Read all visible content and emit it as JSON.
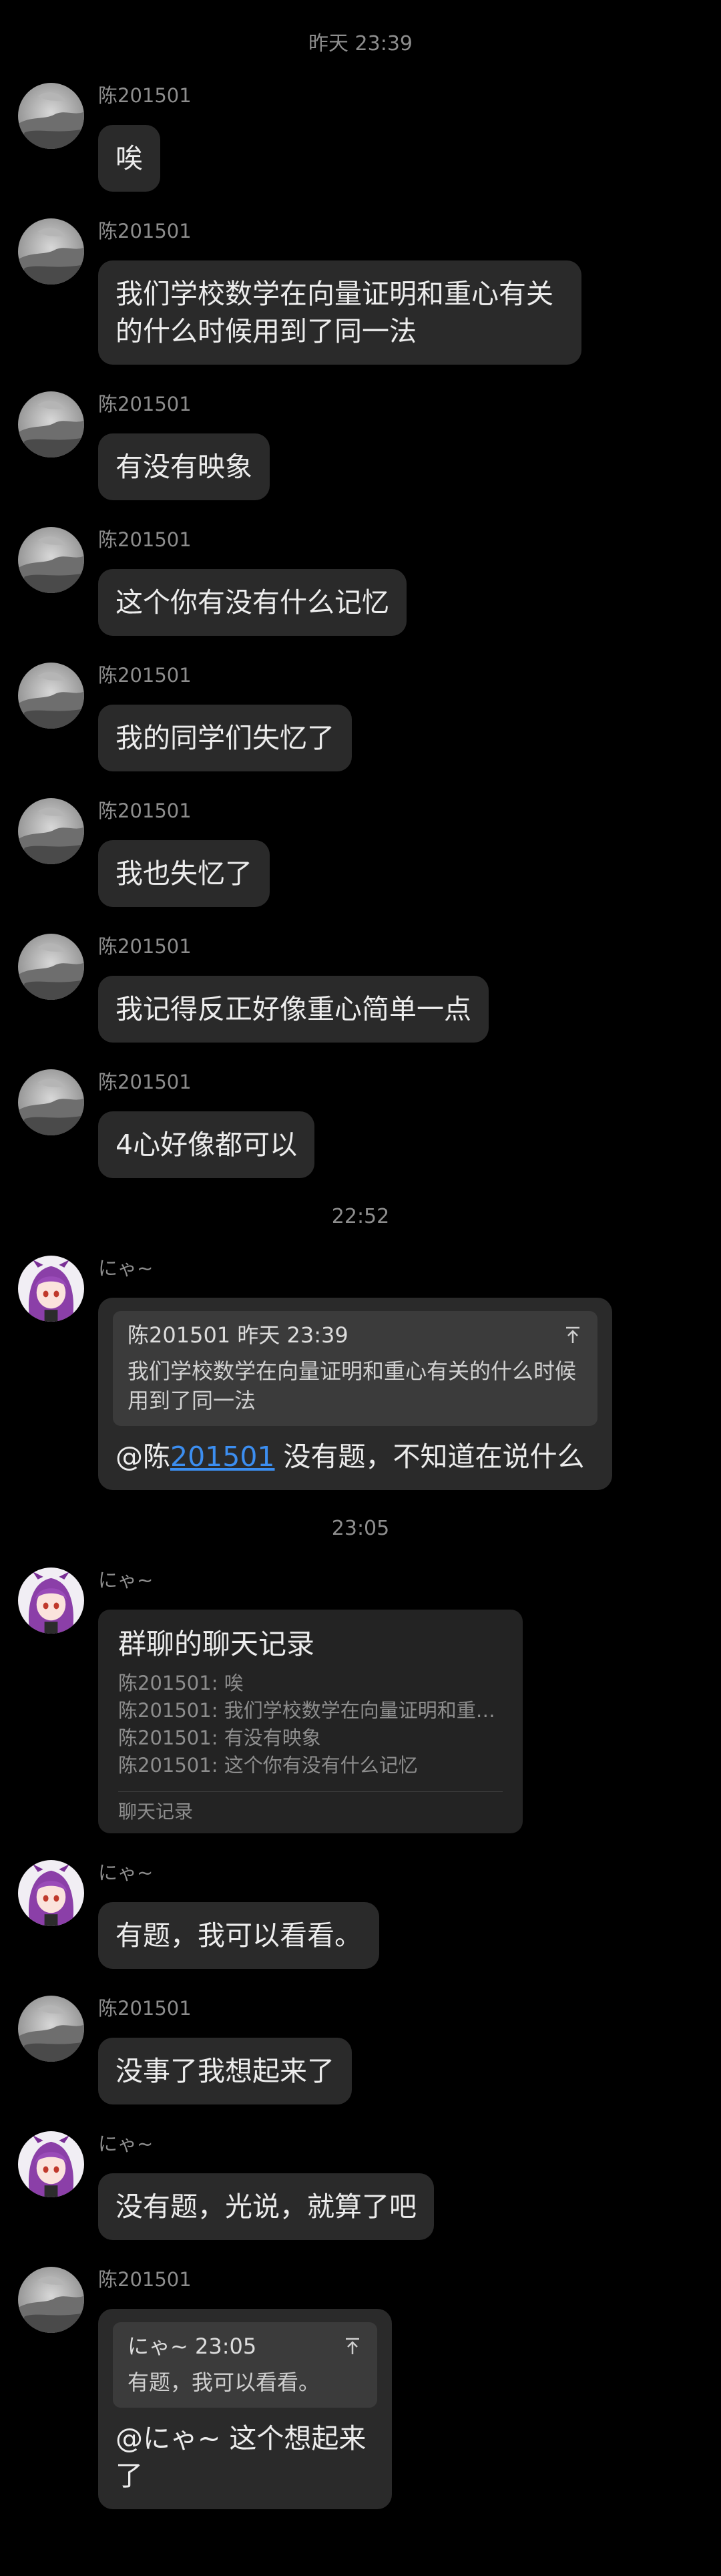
{
  "colors": {
    "background": "#000000",
    "bubble": "#2a2a2a",
    "quote_box": "#3b3b3b",
    "mention_link": "#3c8ef0",
    "meta_text": "#8d8d8d"
  },
  "chat": {
    "time_1": "昨天 23:39",
    "time_2": "22:52",
    "time_3": "23:05",
    "messages": [
      {
        "sender": "陈201501",
        "avatar": "gray-avatar",
        "text": "唉"
      },
      {
        "sender": "陈201501",
        "avatar": "gray-avatar",
        "text": "我们学校数学在向量证明和重心有关的什么时候用到了同一法"
      },
      {
        "sender": "陈201501",
        "avatar": "gray-avatar",
        "text": "有没有映象"
      },
      {
        "sender": "陈201501",
        "avatar": "gray-avatar",
        "text": "这个你有没有什么记忆"
      },
      {
        "sender": "陈201501",
        "avatar": "gray-avatar",
        "text": "我的同学们失忆了"
      },
      {
        "sender": "陈201501",
        "avatar": "gray-avatar",
        "text": "我也失忆了"
      },
      {
        "sender": "陈201501",
        "avatar": "gray-avatar",
        "text": "我记得反正好像重心简单一点"
      },
      {
        "sender": "陈201501",
        "avatar": "gray-avatar",
        "text": "4心好像都可以"
      },
      {
        "sender": "にゃ~",
        "avatar": "anime-avatar",
        "quote_header": "陈201501 昨天 23:39",
        "quote_text": "我们学校数学在向量证明和重心有关的什么时候用到了同一法",
        "reply_prefix": "@陈",
        "reply_link": "201501",
        "reply_suffix": " 没有题，不知道在说什么"
      },
      {
        "sender": "にゃ~",
        "avatar": "anime-avatar",
        "record_title": "群聊的聊天记录",
        "record_lines": [
          "陈201501: 唉",
          "陈201501: 我们学校数学在向量证明和重心...",
          "陈201501: 有没有映象",
          "陈201501: 这个你有没有什么记忆"
        ],
        "record_footer": "聊天记录"
      },
      {
        "sender": "にゃ~",
        "avatar": "anime-avatar",
        "text": "有题，我可以看看。"
      },
      {
        "sender": "陈201501",
        "avatar": "gray-avatar",
        "text": "没事了我想起来了"
      },
      {
        "sender": "にゃ~",
        "avatar": "anime-avatar",
        "text": "没有题，光说，就算了吧"
      },
      {
        "sender": "陈201501",
        "avatar": "gray-avatar",
        "quote_header": "にゃ~ 23:05",
        "quote_text": "有题，我可以看看。",
        "reply_text": "@にゃ~ 这个想起来了"
      }
    ]
  }
}
